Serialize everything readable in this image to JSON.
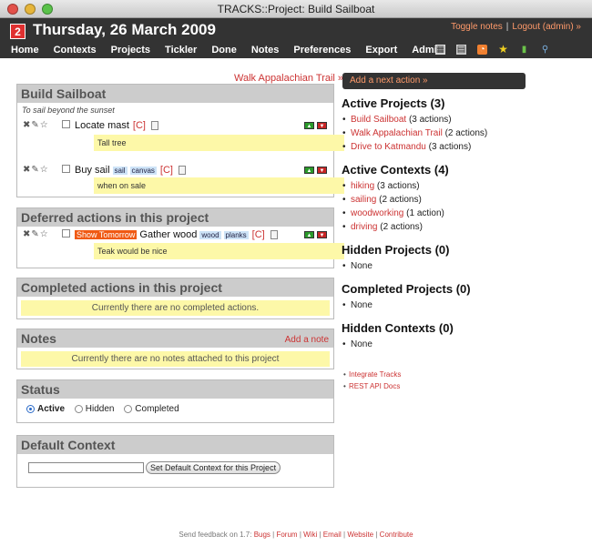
{
  "window": {
    "title": "TRACKS::Project: Build Sailboat"
  },
  "header": {
    "badge": "2",
    "date": "Thursday, 26 March 2009",
    "toggle_notes": "Toggle notes",
    "separator": "|",
    "logout": "Logout (admin) »",
    "nav": [
      "Home",
      "Contexts",
      "Projects",
      "Tickler",
      "Done",
      "Notes",
      "Preferences",
      "Export",
      "Admin"
    ],
    "icons": [
      "calendar-icon",
      "print-icon",
      "rss-icon",
      "star-icon",
      "stats-icon",
      "search-icon"
    ]
  },
  "project_nav": {
    "next": "Walk Appalachian Trail »"
  },
  "project": {
    "title": "Build Sailboat",
    "description": "To sail beyond the sunset",
    "todos": [
      {
        "text": "Locate mast",
        "context": "[C]",
        "note": "Tall tree",
        "tags": []
      },
      {
        "text": "Buy sail",
        "context": "[C]",
        "note": "when on sale",
        "tags": [
          "sail",
          "canvas"
        ]
      }
    ]
  },
  "deferred": {
    "title": "Deferred actions in this project",
    "todo": {
      "show_tomorrow": "Show Tomorrow",
      "text": "Gather wood",
      "tags": [
        "wood",
        "planks"
      ],
      "context": "[C]",
      "note": "Teak would be nice"
    }
  },
  "completed": {
    "title": "Completed actions in this project",
    "empty": "Currently there are no completed actions."
  },
  "notes": {
    "title": "Notes",
    "add": "Add a note",
    "empty": "Currently there are no notes attached to this project"
  },
  "status": {
    "title": "Status",
    "options": [
      "Active",
      "Hidden",
      "Completed"
    ],
    "selected": "Active"
  },
  "default_context": {
    "title": "Default Context",
    "input_value": "",
    "button": "Set Default Context for this Project"
  },
  "sidebar": {
    "add_next": "Add a next action »",
    "active_projects": {
      "title": "Active Projects (3)",
      "items": [
        {
          "name": "Build Sailboat",
          "count": "(3 actions)"
        },
        {
          "name": "Walk Appalachian Trail",
          "count": "(2 actions)"
        },
        {
          "name": "Drive to Katmandu",
          "count": "(3 actions)"
        }
      ]
    },
    "active_contexts": {
      "title": "Active Contexts (4)",
      "items": [
        {
          "name": "hiking",
          "count": "(3 actions)"
        },
        {
          "name": "sailing",
          "count": "(2 actions)"
        },
        {
          "name": "woodworking",
          "count": "(1 action)"
        },
        {
          "name": "driving",
          "count": "(2 actions)"
        }
      ]
    },
    "hidden_projects": {
      "title": "Hidden Projects (0)",
      "none": "None"
    },
    "completed_projects": {
      "title": "Completed Projects (0)",
      "none": "None"
    },
    "hidden_contexts": {
      "title": "Hidden Contexts (0)",
      "none": "None"
    },
    "links": [
      "Integrate Tracks",
      "REST API Docs"
    ]
  },
  "footer": {
    "prefix": "Send feedback on 1.7:",
    "links": [
      "Bugs",
      "Forum",
      "Wiki",
      "Email",
      "Website",
      "Contribute"
    ],
    "separator": "|"
  },
  "colors": {
    "accent": "#cc3333",
    "header_bg": "#333333",
    "note_bg": "#fdf8a8",
    "tag_bg": "#cde3f7",
    "show_tomorrow": "#f05a14"
  }
}
